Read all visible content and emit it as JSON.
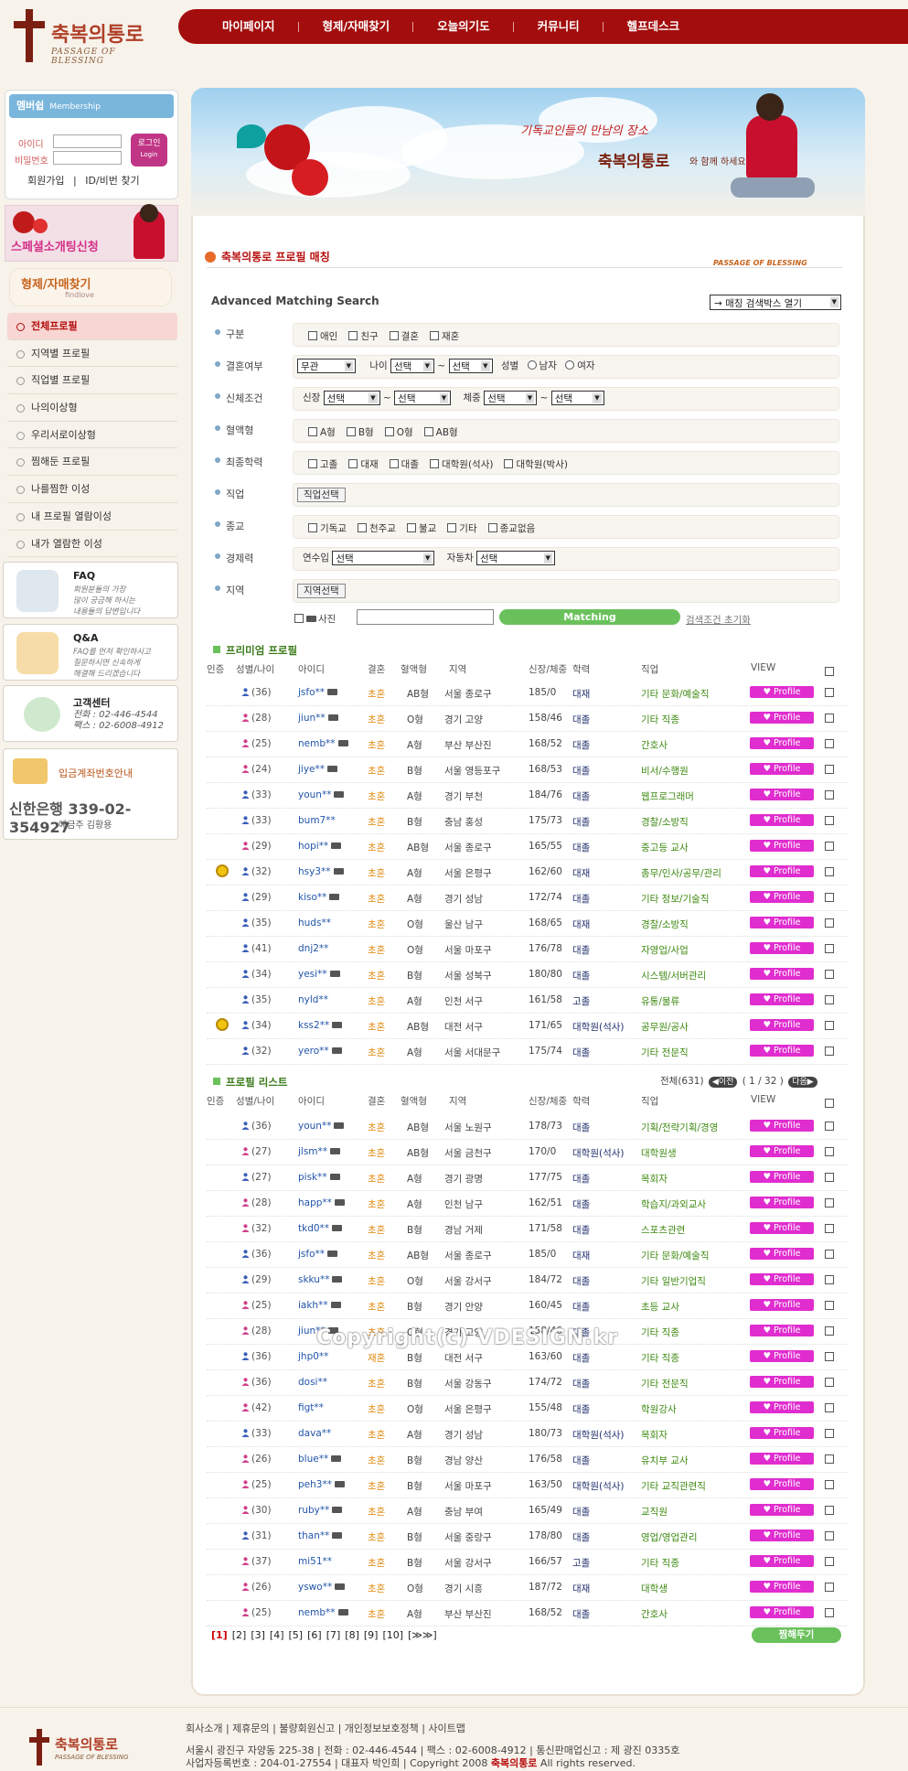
{
  "brand": {
    "name_ko": "축복의통로",
    "name_en": "PASSAGE OF BLESSING"
  },
  "gnb": [
    "마이페이지",
    "형제/자매찾기",
    "오늘의기도",
    "커뮤니티",
    "헬프데스크"
  ],
  "login": {
    "head": "멤버쉽",
    "head_en": "Membership",
    "id_label": "아이디",
    "pw_label": "비밀번호",
    "btn": "로그인",
    "btn_en": "Login",
    "join": "회원가입",
    "find": "ID/비번 찾기",
    "sep": "|"
  },
  "special_banner": "스페셜소개팅신청",
  "findlove": {
    "title": "형제/자매찾기",
    "sub": "findlove"
  },
  "lnb": [
    "전체프로필",
    "지역별 프로필",
    "직업별 프로필",
    "나의이상형",
    "우리서로이상형",
    "찜해둔 프로필",
    "나를찜한 이성",
    "내 프로필 열람이성",
    "내가 열람한 이성"
  ],
  "faq": {
    "title": "FAQ",
    "text": [
      "회원분들의 가장",
      "많이 궁금해 하시는",
      "내용들의 답변입니다"
    ]
  },
  "qna": {
    "title": "Q&A",
    "text": [
      "FAQ를 먼저 확인하시고",
      "질문하시면 신속하게",
      "해결해 드리겠습니다"
    ]
  },
  "center": {
    "title": "고객센터",
    "tel": "전화 : 02-446-4544",
    "fax": "팩스 : 02-6008-4912"
  },
  "bank": {
    "title": "입금계좌번호안내",
    "account": "신한은행 339-02-354927",
    "holder": "예금주 김황용"
  },
  "banner": {
    "quote": "기독교인들의 만남의 장소",
    "brand": "축복의통로",
    "tail": "와 함께 하세요"
  },
  "section": {
    "title": "축복의통로 프로필 매칭",
    "en": "PASSAGE OF BLESSING"
  },
  "adv": {
    "title": "Advanced Matching Search",
    "toggle": "→ 매칭 검색박스 열기"
  },
  "filters": {
    "kind": {
      "label": "구분",
      "opts": [
        "애인",
        "친구",
        "결혼",
        "재혼"
      ]
    },
    "marriage": {
      "label": "결혼여부",
      "sel": "무관",
      "age_label": "나이",
      "sel1": "선택",
      "tilde": "~",
      "sel2": "선택",
      "sex_label": "성별",
      "male": "남자",
      "female": "여자"
    },
    "body": {
      "label": "신체조건",
      "h_label": "신장",
      "h1": "선택",
      "h2": "선택",
      "w_label": "체중",
      "w1": "선택",
      "w2": "선택"
    },
    "blood": {
      "label": "혈액형",
      "opts": [
        "A형",
        "B형",
        "O형",
        "AB형"
      ]
    },
    "edu": {
      "label": "최종학력",
      "opts": [
        "고졸",
        "대재",
        "대졸",
        "대학원(석사)",
        "대학원(박사)"
      ]
    },
    "job": {
      "label": "직업",
      "btn": "직업선택"
    },
    "religion": {
      "label": "종교",
      "opts": [
        "기독교",
        "천주교",
        "불교",
        "기타",
        "종교없음"
      ]
    },
    "econ": {
      "label": "경제력",
      "income": "연수입",
      "income_sel": "선택",
      "car": "자동차",
      "car_sel": "선택"
    },
    "region": {
      "label": "지역",
      "btn": "지역선택"
    },
    "photo": "사진",
    "match_btn": "Matching",
    "reset": "검색조건 초기화"
  },
  "headers": [
    "인증",
    "성별/나이",
    "아이디",
    "결혼",
    "혈액형",
    "지역",
    "신장/체중",
    "학력",
    "직업",
    "VIEW"
  ],
  "premium_title": "프리미엄 프로필",
  "list_title": "프로필 리스트",
  "pager_info": {
    "total": "전체(631)",
    "prev": "◀이전",
    "page": "( 1 / 32 )",
    "next": "다음▶"
  },
  "view_label": "♥ Profile",
  "premium": [
    {
      "g": "m",
      "age": "(36)",
      "id": "jsfo**",
      "cam": true,
      "mar": "초혼",
      "blood": "AB형",
      "region": "서울 종로구",
      "hw": "185/0",
      "edu": "대재",
      "job": "기타 문화/예술직"
    },
    {
      "g": "f",
      "age": "(28)",
      "id": "jiun**",
      "cam": true,
      "mar": "초혼",
      "blood": "O형",
      "region": "경기 고양",
      "hw": "158/46",
      "edu": "대졸",
      "job": "기타 직종"
    },
    {
      "g": "f",
      "age": "(25)",
      "id": "nemb**",
      "cam": true,
      "mar": "초혼",
      "blood": "A형",
      "region": "부산 부산진",
      "hw": "168/52",
      "edu": "대졸",
      "job": "간호사"
    },
    {
      "g": "f",
      "age": "(24)",
      "id": "jiye**",
      "cam": true,
      "mar": "초혼",
      "blood": "B형",
      "region": "서울 영등포구",
      "hw": "168/53",
      "edu": "대졸",
      "job": "비서/수행원"
    },
    {
      "g": "m",
      "age": "(33)",
      "id": "youn**",
      "cam": true,
      "mar": "초혼",
      "blood": "A형",
      "region": "경기 부천",
      "hw": "184/76",
      "edu": "대졸",
      "job": "웹프로그래머"
    },
    {
      "g": "m",
      "age": "(33)",
      "id": "bum7**",
      "cam": false,
      "mar": "초혼",
      "blood": "B형",
      "region": "충남 홍성",
      "hw": "175/73",
      "edu": "대졸",
      "job": "경찰/소방직"
    },
    {
      "g": "f",
      "age": "(29)",
      "id": "hopi**",
      "cam": true,
      "mar": "초혼",
      "blood": "AB형",
      "region": "서울 종로구",
      "hw": "165/55",
      "edu": "대졸",
      "job": "중고등 교사"
    },
    {
      "g": "m",
      "age": "(32)",
      "id": "hsy3**",
      "cam": true,
      "mar": "초혼",
      "blood": "A형",
      "region": "서울 은평구",
      "hw": "162/60",
      "edu": "대재",
      "job": "총무/인사/공무/관리",
      "auth": true
    },
    {
      "g": "m",
      "age": "(29)",
      "id": "kiso**",
      "cam": true,
      "mar": "초혼",
      "blood": "A형",
      "region": "경기 성남",
      "hw": "172/74",
      "edu": "대졸",
      "job": "기타 정보/기술직"
    },
    {
      "g": "m",
      "age": "(35)",
      "id": "huds**",
      "cam": false,
      "mar": "초혼",
      "blood": "O형",
      "region": "울산 남구",
      "hw": "168/65",
      "edu": "대재",
      "job": "경찰/소방직"
    },
    {
      "g": "m",
      "age": "(41)",
      "id": "dnj2**",
      "cam": false,
      "mar": "초혼",
      "blood": "O형",
      "region": "서울 마포구",
      "hw": "176/78",
      "edu": "대졸",
      "job": "자영업/사업"
    },
    {
      "g": "m",
      "age": "(34)",
      "id": "yesi**",
      "cam": true,
      "mar": "초혼",
      "blood": "B형",
      "region": "서울 성북구",
      "hw": "180/80",
      "edu": "대졸",
      "job": "시스템/서버관리"
    },
    {
      "g": "m",
      "age": "(35)",
      "id": "nyld**",
      "cam": false,
      "mar": "초혼",
      "blood": "A형",
      "region": "인천 서구",
      "hw": "161/58",
      "edu": "고졸",
      "job": "유통/물류"
    },
    {
      "g": "m",
      "age": "(34)",
      "id": "kss2**",
      "cam": true,
      "mar": "초혼",
      "blood": "AB형",
      "region": "대전 서구",
      "hw": "171/65",
      "edu": "대학원(석사)",
      "job": "공무원/공사",
      "auth": true
    },
    {
      "g": "m",
      "age": "(32)",
      "id": "yero**",
      "cam": true,
      "mar": "초혼",
      "blood": "A형",
      "region": "서울 서대문구",
      "hw": "175/74",
      "edu": "대졸",
      "job": "기타 전문직"
    }
  ],
  "list": [
    {
      "g": "m",
      "age": "(36)",
      "id": "youn**",
      "cam": true,
      "mar": "초혼",
      "blood": "AB형",
      "region": "서울 노원구",
      "hw": "178/73",
      "edu": "대졸",
      "job": "기획/전략기획/경영"
    },
    {
      "g": "f",
      "age": "(27)",
      "id": "jlsm**",
      "cam": true,
      "mar": "초혼",
      "blood": "AB형",
      "region": "서울 금천구",
      "hw": "170/0",
      "edu": "대학원(석사)",
      "job": "대학원생"
    },
    {
      "g": "m",
      "age": "(27)",
      "id": "pisk**",
      "cam": true,
      "mar": "초혼",
      "blood": "A형",
      "region": "경기 광명",
      "hw": "177/75",
      "edu": "대졸",
      "job": "목회자"
    },
    {
      "g": "f",
      "age": "(28)",
      "id": "happ**",
      "cam": true,
      "mar": "초혼",
      "blood": "A형",
      "region": "인천 남구",
      "hw": "162/51",
      "edu": "대졸",
      "job": "학습지/과외교사"
    },
    {
      "g": "f",
      "age": "(32)",
      "id": "tkd0**",
      "cam": true,
      "mar": "초혼",
      "blood": "B형",
      "region": "경남 거제",
      "hw": "171/58",
      "edu": "대졸",
      "job": "스포츠관련"
    },
    {
      "g": "m",
      "age": "(36)",
      "id": "jsfo**",
      "cam": true,
      "mar": "초혼",
      "blood": "AB형",
      "region": "서울 종로구",
      "hw": "185/0",
      "edu": "대재",
      "job": "기타 문화/예술직"
    },
    {
      "g": "m",
      "age": "(29)",
      "id": "skku**",
      "cam": true,
      "mar": "초혼",
      "blood": "O형",
      "region": "서울 강서구",
      "hw": "184/72",
      "edu": "대졸",
      "job": "기타 일반기업직"
    },
    {
      "g": "f",
      "age": "(25)",
      "id": "iakh**",
      "cam": true,
      "mar": "초혼",
      "blood": "B형",
      "region": "경기 안양",
      "hw": "160/45",
      "edu": "대졸",
      "job": "초등 교사"
    },
    {
      "g": "f",
      "age": "(28)",
      "id": "jiun**",
      "cam": true,
      "mar": "초혼",
      "blood": "O형",
      "region": "경기 고양",
      "hw": "158/46",
      "edu": "대졸",
      "job": "기타 직종"
    },
    {
      "g": "m",
      "age": "(36)",
      "id": "jhp0**",
      "cam": false,
      "mar": "재혼",
      "blood": "B형",
      "region": "대전 서구",
      "hw": "163/60",
      "edu": "대졸",
      "job": "기타 직종"
    },
    {
      "g": "f",
      "age": "(36)",
      "id": "dosi**",
      "cam": false,
      "mar": "초혼",
      "blood": "B형",
      "region": "서울 강동구",
      "hw": "174/72",
      "edu": "대졸",
      "job": "기타 전문직"
    },
    {
      "g": "f",
      "age": "(42)",
      "id": "figt**",
      "cam": false,
      "mar": "초혼",
      "blood": "O형",
      "region": "서울 은평구",
      "hw": "155/48",
      "edu": "대졸",
      "job": "학원강사"
    },
    {
      "g": "m",
      "age": "(33)",
      "id": "dava**",
      "cam": false,
      "mar": "초혼",
      "blood": "A형",
      "region": "경기 성남",
      "hw": "180/73",
      "edu": "대학원(석사)",
      "job": "목회자"
    },
    {
      "g": "f",
      "age": "(26)",
      "id": "blue**",
      "cam": true,
      "mar": "초혼",
      "blood": "B형",
      "region": "경남 양산",
      "hw": "176/58",
      "edu": "대졸",
      "job": "유치부 교사"
    },
    {
      "g": "f",
      "age": "(25)",
      "id": "peh3**",
      "cam": true,
      "mar": "초혼",
      "blood": "B형",
      "region": "서울 마포구",
      "hw": "163/50",
      "edu": "대학원(석사)",
      "job": "기타 교직관련직"
    },
    {
      "g": "f",
      "age": "(30)",
      "id": "ruby**",
      "cam": true,
      "mar": "초혼",
      "blood": "A형",
      "region": "충남 부여",
      "hw": "165/49",
      "edu": "대졸",
      "job": "교직원"
    },
    {
      "g": "m",
      "age": "(31)",
      "id": "than**",
      "cam": true,
      "mar": "초혼",
      "blood": "B형",
      "region": "서울 중랑구",
      "hw": "178/80",
      "edu": "대졸",
      "job": "영업/영업관리"
    },
    {
      "g": "f",
      "age": "(37)",
      "id": "mi51**",
      "cam": false,
      "mar": "초혼",
      "blood": "B형",
      "region": "서울 강서구",
      "hw": "166/57",
      "edu": "고졸",
      "job": "기타 직종"
    },
    {
      "g": "f",
      "age": "(26)",
      "id": "yswo**",
      "cam": true,
      "mar": "초혼",
      "blood": "O형",
      "region": "경기 시흥",
      "hw": "187/72",
      "edu": "대재",
      "job": "대학생"
    },
    {
      "g": "f",
      "age": "(25)",
      "id": "nemb**",
      "cam": true,
      "mar": "초혼",
      "blood": "A형",
      "region": "부산 부산진",
      "hw": "168/52",
      "edu": "대졸",
      "job": "간호사"
    }
  ],
  "pages": [
    "[1]",
    "[2]",
    "[3]",
    "[4]",
    "[5]",
    "[6]",
    "[7]",
    "[8]",
    "[9]",
    "[10]",
    "[≫≫]"
  ],
  "keep_btn": "찜해두기",
  "watermark": "Copyright(c) VDESIGN.kr",
  "footer": {
    "links": "회사소개 | 제휴문의 | 불량회원신고 | 개인정보보호정책 | 사이트맵",
    "addr1": "서울시 광진구 자양동 225-38  |  전화 : 02-446-4544  |  팩스 : 02-6008-4912  |  통신판매업신고 : 제 광진 0335호",
    "addr2": "사업자등록번호 : 204-01-27554  |  대표자 박인희  |  Copyright 2008",
    "brand": "축복의통로",
    "rights": " All rights reserved."
  },
  "colors": {
    "gnb": "#a30d0d",
    "view_btn": "#e02dcf",
    "match_btn": "#6ac15b",
    "male_icon": "#3a5fb8",
    "female_icon": "#d0408a"
  }
}
